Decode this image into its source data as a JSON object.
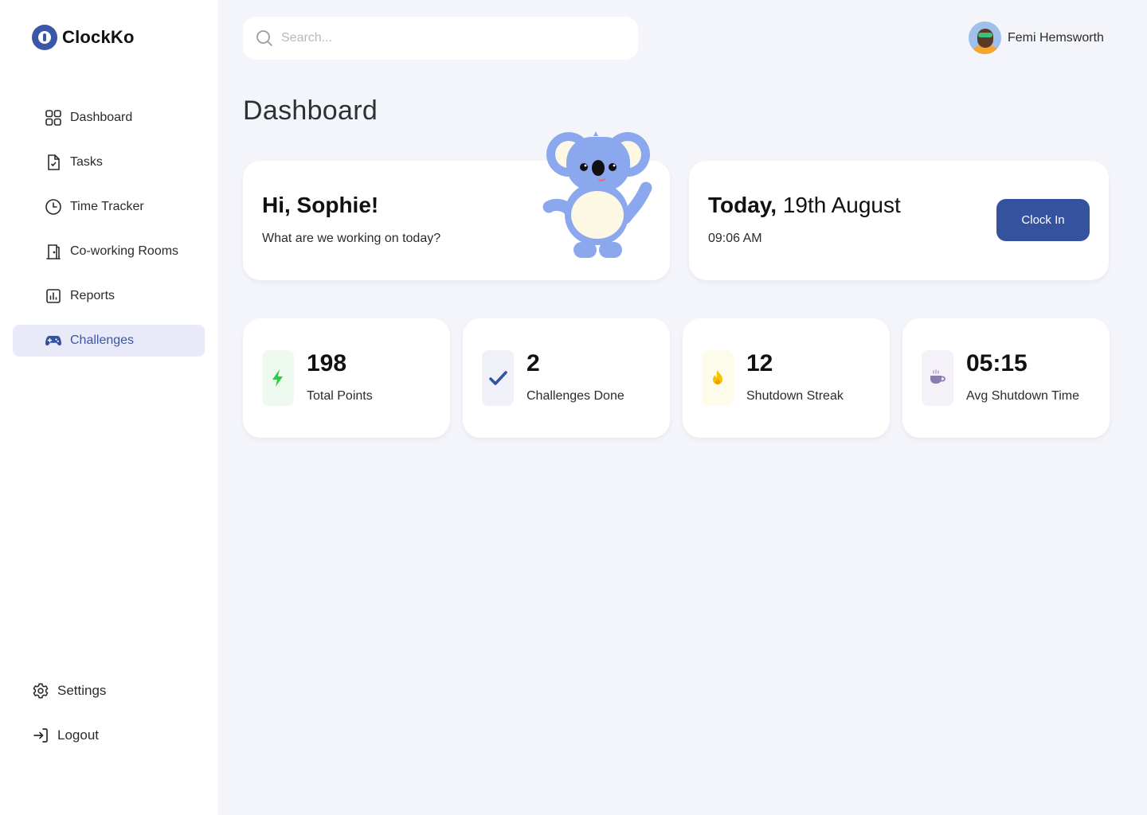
{
  "app": {
    "name": "ClockKo"
  },
  "sidebar": {
    "items": [
      {
        "label": "Dashboard",
        "icon": "grid-icon"
      },
      {
        "label": "Tasks",
        "icon": "task-file-icon"
      },
      {
        "label": "Time Tracker",
        "icon": "clock-icon"
      },
      {
        "label": "Co-working Rooms",
        "icon": "door-icon"
      },
      {
        "label": "Reports",
        "icon": "bar-chart-icon"
      },
      {
        "label": "Challenges",
        "icon": "gamepad-icon",
        "active": true
      }
    ],
    "bottom": [
      {
        "label": "Settings",
        "icon": "gear-icon"
      },
      {
        "label": "Logout",
        "icon": "logout-icon"
      }
    ]
  },
  "search": {
    "placeholder": "Search..."
  },
  "user": {
    "name": "Femi Hemsworth"
  },
  "page": {
    "title": "Dashboard"
  },
  "greeting": {
    "title": "Hi, Sophie!",
    "subtitle": "What are we working on today?"
  },
  "today": {
    "prefix": "Today,",
    "date": "19th August",
    "time": "09:06 AM",
    "button": "Clock In"
  },
  "stats": [
    {
      "value": "198",
      "label": "Total Points",
      "icon": "lightning-icon",
      "color": "#2ecc40",
      "bg": "#eefaf0"
    },
    {
      "value": "2",
      "label": "Challenges Done",
      "icon": "checkmark-icon",
      "color": "#34529e",
      "bg": "#f0f1f8"
    },
    {
      "value": "12",
      "label": "Shutdown Streak",
      "icon": "flame-icon",
      "color": "#f5c400",
      "bg": "#fdfbe9"
    },
    {
      "value": "05:15",
      "label": "Avg Shutdown Time",
      "icon": "coffee-cup-icon",
      "color": "#8a7bb0",
      "bg": "#f4f2f8"
    }
  ],
  "colors": {
    "accent": "#34529e",
    "active_bg": "#e9eaf7",
    "background": "#f4f5fa"
  }
}
